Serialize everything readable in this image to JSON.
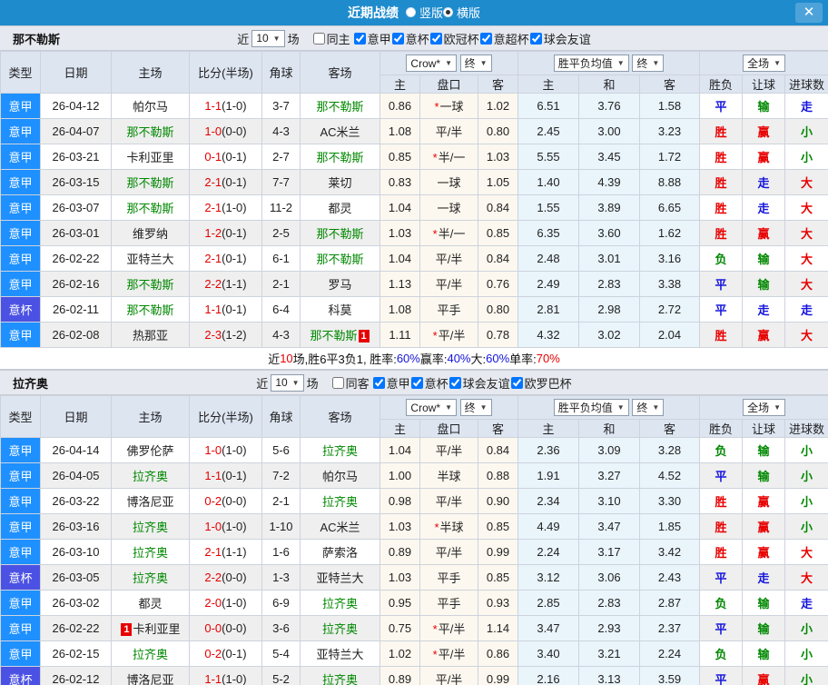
{
  "titlebar": {
    "title": "近期战绩",
    "radio_options": [
      {
        "label": "竖版",
        "selected": false
      },
      {
        "label": "横版",
        "selected": true
      }
    ],
    "close_icon": "✕"
  },
  "table_template": {
    "main_columns": [
      "类型",
      "日期",
      "主场",
      "比分(半场)",
      "角球",
      "客场"
    ],
    "sub_columns": [
      "主",
      "盘口",
      "客",
      "主",
      "和",
      "客",
      "胜负",
      "让球",
      "进球数"
    ],
    "odds_source_select": "Crow*",
    "odds_final_select": "终",
    "avg_source_select": "胜平负均值",
    "avg_final_select": "终",
    "scope_select": "全场"
  },
  "colors": {
    "titlebar_bg": "#1e8bcd",
    "league_type_bg": "#1e90ff",
    "cup_type_bg": "#4b52e3",
    "win_red": "#e80000",
    "draw_blue": "#1414dc",
    "lose_green": "#008800"
  },
  "sections": [
    {
      "team": "那不勒斯",
      "filter": {
        "near": "近",
        "count": "10",
        "games": "场",
        "same": "同主",
        "same_checked": false,
        "leagues": [
          {
            "label": "意甲",
            "checked": true
          },
          {
            "label": "意杯",
            "checked": true
          },
          {
            "label": "欧冠杯",
            "checked": true
          },
          {
            "label": "意超杯",
            "checked": true
          },
          {
            "label": "球会友谊",
            "checked": true
          }
        ]
      },
      "rows": [
        {
          "type": "意甲",
          "cup": false,
          "date": "26-04-12",
          "home": "帕尔马",
          "home_green": false,
          "home_badge": "",
          "score": "1-1",
          "half": "(1-0)",
          "corner": "3-7",
          "away": "那不勒斯",
          "away_green": true,
          "away_badge": "",
          "o1": "0.86",
          "hc": "一球",
          "hc_star": true,
          "o2": "1.02",
          "a1": "6.51",
          "a2": "3.76",
          "a3": "1.58",
          "r1": "平",
          "c1": "b",
          "r2": "输",
          "c2": "g",
          "r3": "走",
          "c3": "b"
        },
        {
          "type": "意甲",
          "cup": false,
          "date": "26-04-07",
          "home": "那不勒斯",
          "home_green": true,
          "home_badge": "",
          "score": "1-0",
          "half": "(0-0)",
          "corner": "4-3",
          "away": "AC米兰",
          "away_green": false,
          "away_badge": "",
          "o1": "1.08",
          "hc": "平/半",
          "hc_star": false,
          "o2": "0.80",
          "a1": "2.45",
          "a2": "3.00",
          "a3": "3.23",
          "r1": "胜",
          "c1": "r",
          "r2": "赢",
          "c2": "r",
          "r3": "小",
          "c3": "g"
        },
        {
          "type": "意甲",
          "cup": false,
          "date": "26-03-21",
          "home": "卡利亚里",
          "home_green": false,
          "home_badge": "",
          "score": "0-1",
          "half": "(0-1)",
          "corner": "2-7",
          "away": "那不勒斯",
          "away_green": true,
          "away_badge": "",
          "o1": "0.85",
          "hc": "半/一",
          "hc_star": true,
          "o2": "1.03",
          "a1": "5.55",
          "a2": "3.45",
          "a3": "1.72",
          "r1": "胜",
          "c1": "r",
          "r2": "赢",
          "c2": "r",
          "r3": "小",
          "c3": "g"
        },
        {
          "type": "意甲",
          "cup": false,
          "date": "26-03-15",
          "home": "那不勒斯",
          "home_green": true,
          "home_badge": "",
          "score": "2-1",
          "half": "(0-1)",
          "corner": "7-7",
          "away": "莱切",
          "away_green": false,
          "away_badge": "",
          "o1": "0.83",
          "hc": "一球",
          "hc_star": false,
          "o2": "1.05",
          "a1": "1.40",
          "a2": "4.39",
          "a3": "8.88",
          "r1": "胜",
          "c1": "r",
          "r2": "走",
          "c2": "b",
          "r3": "大",
          "c3": "r"
        },
        {
          "type": "意甲",
          "cup": false,
          "date": "26-03-07",
          "home": "那不勒斯",
          "home_green": true,
          "home_badge": "",
          "score": "2-1",
          "half": "(1-0)",
          "corner": "11-2",
          "away": "都灵",
          "away_green": false,
          "away_badge": "",
          "o1": "1.04",
          "hc": "一球",
          "hc_star": false,
          "o2": "0.84",
          "a1": "1.55",
          "a2": "3.89",
          "a3": "6.65",
          "r1": "胜",
          "c1": "r",
          "r2": "走",
          "c2": "b",
          "r3": "大",
          "c3": "r"
        },
        {
          "type": "意甲",
          "cup": false,
          "date": "26-03-01",
          "home": "维罗纳",
          "home_green": false,
          "home_badge": "",
          "score": "1-2",
          "half": "(0-1)",
          "corner": "2-5",
          "away": "那不勒斯",
          "away_green": true,
          "away_badge": "",
          "o1": "1.03",
          "hc": "半/一",
          "hc_star": true,
          "o2": "0.85",
          "a1": "6.35",
          "a2": "3.60",
          "a3": "1.62",
          "r1": "胜",
          "c1": "r",
          "r2": "赢",
          "c2": "r",
          "r3": "大",
          "c3": "r"
        },
        {
          "type": "意甲",
          "cup": false,
          "date": "26-02-22",
          "home": "亚特兰大",
          "home_green": false,
          "home_badge": "",
          "score": "2-1",
          "half": "(0-1)",
          "corner": "6-1",
          "away": "那不勒斯",
          "away_green": true,
          "away_badge": "",
          "o1": "1.04",
          "hc": "平/半",
          "hc_star": false,
          "o2": "0.84",
          "a1": "2.48",
          "a2": "3.01",
          "a3": "3.16",
          "r1": "负",
          "c1": "g",
          "r2": "输",
          "c2": "g",
          "r3": "大",
          "c3": "r"
        },
        {
          "type": "意甲",
          "cup": false,
          "date": "26-02-16",
          "home": "那不勒斯",
          "home_green": true,
          "home_badge": "",
          "score": "2-2",
          "half": "(1-1)",
          "corner": "2-1",
          "away": "罗马",
          "away_green": false,
          "away_badge": "",
          "o1": "1.13",
          "hc": "平/半",
          "hc_star": false,
          "o2": "0.76",
          "a1": "2.49",
          "a2": "2.83",
          "a3": "3.38",
          "r1": "平",
          "c1": "b",
          "r2": "输",
          "c2": "g",
          "r3": "大",
          "c3": "r"
        },
        {
          "type": "意杯",
          "cup": true,
          "date": "26-02-11",
          "home": "那不勒斯",
          "home_green": true,
          "home_badge": "",
          "score": "1-1",
          "half": "(0-1)",
          "corner": "6-4",
          "away": "科莫",
          "away_green": false,
          "away_badge": "",
          "o1": "1.08",
          "hc": "平手",
          "hc_star": false,
          "o2": "0.80",
          "a1": "2.81",
          "a2": "2.98",
          "a3": "2.72",
          "r1": "平",
          "c1": "b",
          "r2": "走",
          "c2": "b",
          "r3": "走",
          "c3": "b"
        },
        {
          "type": "意甲",
          "cup": false,
          "date": "26-02-08",
          "home": "热那亚",
          "home_green": false,
          "home_badge": "",
          "score": "2-3",
          "half": "(1-2)",
          "corner": "4-3",
          "away": "那不勒斯",
          "away_green": true,
          "away_badge": "1",
          "o1": "1.11",
          "hc": "平/半",
          "hc_star": true,
          "o2": "0.78",
          "a1": "4.32",
          "a2": "3.02",
          "a3": "2.04",
          "r1": "胜",
          "c1": "r",
          "r2": "赢",
          "c2": "r",
          "r3": "大",
          "c3": "r"
        }
      ],
      "summary": [
        {
          "t": "近",
          "c": "k"
        },
        {
          "t": "10",
          "c": "r"
        },
        {
          "t": "场,胜6平3负1, 胜率:",
          "c": "k"
        },
        {
          "t": "60%",
          "c": "b"
        },
        {
          "t": " 赢率:",
          "c": "k"
        },
        {
          "t": "40%",
          "c": "b"
        },
        {
          "t": " 大:",
          "c": "k"
        },
        {
          "t": "60%",
          "c": "b"
        },
        {
          "t": " 单率:",
          "c": "k"
        },
        {
          "t": "70%",
          "c": "r"
        }
      ]
    },
    {
      "team": "拉齐奥",
      "filter": {
        "near": "近",
        "count": "10",
        "games": "场",
        "same": "同客",
        "same_checked": false,
        "leagues": [
          {
            "label": "意甲",
            "checked": true
          },
          {
            "label": "意杯",
            "checked": true
          },
          {
            "label": "球会友谊",
            "checked": true
          },
          {
            "label": "欧罗巴杯",
            "checked": true
          }
        ]
      },
      "rows": [
        {
          "type": "意甲",
          "cup": false,
          "date": "26-04-14",
          "home": "佛罗伦萨",
          "home_green": false,
          "home_badge": "",
          "score": "1-0",
          "half": "(1-0)",
          "corner": "5-6",
          "away": "拉齐奥",
          "away_green": true,
          "away_badge": "",
          "o1": "1.04",
          "hc": "平/半",
          "hc_star": false,
          "o2": "0.84",
          "a1": "2.36",
          "a2": "3.09",
          "a3": "3.28",
          "r1": "负",
          "c1": "g",
          "r2": "输",
          "c2": "g",
          "r3": "小",
          "c3": "g"
        },
        {
          "type": "意甲",
          "cup": false,
          "date": "26-04-05",
          "home": "拉齐奥",
          "home_green": true,
          "home_badge": "",
          "score": "1-1",
          "half": "(0-1)",
          "corner": "7-2",
          "away": "帕尔马",
          "away_green": false,
          "away_badge": "",
          "o1": "1.00",
          "hc": "半球",
          "hc_star": false,
          "o2": "0.88",
          "a1": "1.91",
          "a2": "3.27",
          "a3": "4.52",
          "r1": "平",
          "c1": "b",
          "r2": "输",
          "c2": "g",
          "r3": "小",
          "c3": "g"
        },
        {
          "type": "意甲",
          "cup": false,
          "date": "26-03-22",
          "home": "博洛尼亚",
          "home_green": false,
          "home_badge": "",
          "score": "0-2",
          "half": "(0-0)",
          "corner": "2-1",
          "away": "拉齐奥",
          "away_green": true,
          "away_badge": "",
          "o1": "0.98",
          "hc": "平/半",
          "hc_star": false,
          "o2": "0.90",
          "a1": "2.34",
          "a2": "3.10",
          "a3": "3.30",
          "r1": "胜",
          "c1": "r",
          "r2": "赢",
          "c2": "r",
          "r3": "小",
          "c3": "g"
        },
        {
          "type": "意甲",
          "cup": false,
          "date": "26-03-16",
          "home": "拉齐奥",
          "home_green": true,
          "home_badge": "",
          "score": "1-0",
          "half": "(1-0)",
          "corner": "1-10",
          "away": "AC米兰",
          "away_green": false,
          "away_badge": "",
          "o1": "1.03",
          "hc": "半球",
          "hc_star": true,
          "o2": "0.85",
          "a1": "4.49",
          "a2": "3.47",
          "a3": "1.85",
          "r1": "胜",
          "c1": "r",
          "r2": "赢",
          "c2": "r",
          "r3": "小",
          "c3": "g"
        },
        {
          "type": "意甲",
          "cup": false,
          "date": "26-03-10",
          "home": "拉齐奥",
          "home_green": true,
          "home_badge": "",
          "score": "2-1",
          "half": "(1-1)",
          "corner": "1-6",
          "away": "萨索洛",
          "away_green": false,
          "away_badge": "",
          "o1": "0.89",
          "hc": "平/半",
          "hc_star": false,
          "o2": "0.99",
          "a1": "2.24",
          "a2": "3.17",
          "a3": "3.42",
          "r1": "胜",
          "c1": "r",
          "r2": "赢",
          "c2": "r",
          "r3": "大",
          "c3": "r"
        },
        {
          "type": "意杯",
          "cup": true,
          "date": "26-03-05",
          "home": "拉齐奥",
          "home_green": true,
          "home_badge": "",
          "score": "2-2",
          "half": "(0-0)",
          "corner": "1-3",
          "away": "亚特兰大",
          "away_green": false,
          "away_badge": "",
          "o1": "1.03",
          "hc": "平手",
          "hc_star": false,
          "o2": "0.85",
          "a1": "3.12",
          "a2": "3.06",
          "a3": "2.43",
          "r1": "平",
          "c1": "b",
          "r2": "走",
          "c2": "b",
          "r3": "大",
          "c3": "r"
        },
        {
          "type": "意甲",
          "cup": false,
          "date": "26-03-02",
          "home": "都灵",
          "home_green": false,
          "home_badge": "",
          "score": "2-0",
          "half": "(1-0)",
          "corner": "6-9",
          "away": "拉齐奥",
          "away_green": true,
          "away_badge": "",
          "o1": "0.95",
          "hc": "平手",
          "hc_star": false,
          "o2": "0.93",
          "a1": "2.85",
          "a2": "2.83",
          "a3": "2.87",
          "r1": "负",
          "c1": "g",
          "r2": "输",
          "c2": "g",
          "r3": "走",
          "c3": "b"
        },
        {
          "type": "意甲",
          "cup": false,
          "date": "26-02-22",
          "home": "卡利亚里",
          "home_green": false,
          "home_badge": "1",
          "score": "0-0",
          "half": "(0-0)",
          "corner": "3-6",
          "away": "拉齐奥",
          "away_green": true,
          "away_badge": "",
          "o1": "0.75",
          "hc": "平/半",
          "hc_star": true,
          "o2": "1.14",
          "a1": "3.47",
          "a2": "2.93",
          "a3": "2.37",
          "r1": "平",
          "c1": "b",
          "r2": "输",
          "c2": "g",
          "r3": "小",
          "c3": "g"
        },
        {
          "type": "意甲",
          "cup": false,
          "date": "26-02-15",
          "home": "拉齐奥",
          "home_green": true,
          "home_badge": "",
          "score": "0-2",
          "half": "(0-1)",
          "corner": "5-4",
          "away": "亚特兰大",
          "away_green": false,
          "away_badge": "",
          "o1": "1.02",
          "hc": "平/半",
          "hc_star": true,
          "o2": "0.86",
          "a1": "3.40",
          "a2": "3.21",
          "a3": "2.24",
          "r1": "负",
          "c1": "g",
          "r2": "输",
          "c2": "g",
          "r3": "小",
          "c3": "g"
        },
        {
          "type": "意杯",
          "cup": true,
          "date": "26-02-12",
          "home": "博洛尼亚",
          "home_green": false,
          "home_badge": "",
          "score": "1-1",
          "half": "(1-0)",
          "corner": "5-2",
          "away": "拉齐奥",
          "away_green": true,
          "away_badge": "",
          "o1": "0.89",
          "hc": "平/半",
          "hc_star": false,
          "o2": "0.99",
          "a1": "2.16",
          "a2": "3.13",
          "a3": "3.59",
          "r1": "平",
          "c1": "b",
          "r2": "赢",
          "c2": "r",
          "r3": "小",
          "c3": "g"
        }
      ],
      "summary": null
    }
  ]
}
